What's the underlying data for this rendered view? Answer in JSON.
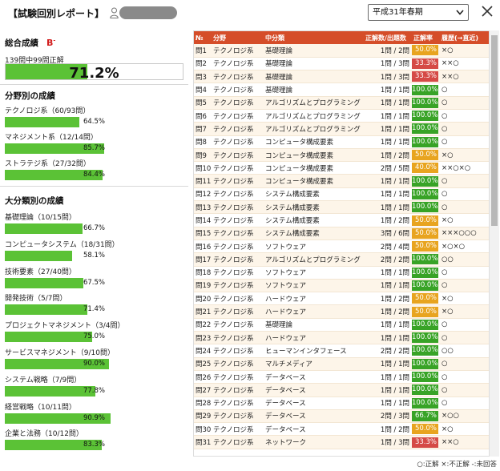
{
  "header": {
    "title": "【試験回別レポート】",
    "exam_selected": "平成31年春期"
  },
  "summary": {
    "heading": "総合成績",
    "grade": "B",
    "grade_mark": "-",
    "correct_text": "139問中99問正解",
    "rate_text": "71.2%",
    "rate": 71.2
  },
  "field": {
    "heading": "分野別の成績",
    "items": [
      {
        "label": "テクノロジ系（60/93問）",
        "pct_text": "64.5%",
        "pct": 64.5
      },
      {
        "label": "マネジメント系（12/14問）",
        "pct_text": "85.7%",
        "pct": 85.7
      },
      {
        "label": "ストラテジ系（27/32問）",
        "pct_text": "84.4%",
        "pct": 84.4
      }
    ]
  },
  "major": {
    "heading": "大分類別の成績",
    "items": [
      {
        "label": "基礎理論（10/15問）",
        "pct_text": "66.7%",
        "pct": 66.7
      },
      {
        "label": "コンピュータシステム（18/31問）",
        "pct_text": "58.1%",
        "pct": 58.1
      },
      {
        "label": "技術要素（27/40問）",
        "pct_text": "67.5%",
        "pct": 67.5
      },
      {
        "label": "開発技術（5/7問）",
        "pct_text": "71.4%",
        "pct": 71.4
      },
      {
        "label": "プロジェクトマネジメント（3/4問）",
        "pct_text": "75.0%",
        "pct": 75.0
      },
      {
        "label": "サービスマネジメント（9/10問）",
        "pct_text": "90.0%",
        "pct": 90.0
      },
      {
        "label": "システム戦略（7/9問）",
        "pct_text": "77.8%",
        "pct": 77.8
      },
      {
        "label": "経営戦略（10/11問）",
        "pct_text": "90.9%",
        "pct": 90.9
      },
      {
        "label": "企業と法務（10/12問）",
        "pct_text": "83.3%",
        "pct": 83.3
      }
    ]
  },
  "table": {
    "headers": [
      "№",
      "分野",
      "中分類",
      "正解数/出題数",
      "正解率",
      "履歴(→直近)"
    ],
    "rows": [
      {
        "no": "問1",
        "field": "テクノロジ系",
        "category": "基礎理論",
        "ratio": "1問 / 2問",
        "rate": "50.0%",
        "level": "o",
        "history": "×○"
      },
      {
        "no": "問2",
        "field": "テクノロジ系",
        "category": "基礎理論",
        "ratio": "1問 / 3問",
        "rate": "33.3%",
        "level": "r",
        "history": "××○"
      },
      {
        "no": "問3",
        "field": "テクノロジ系",
        "category": "基礎理論",
        "ratio": "1問 / 3問",
        "rate": "33.3%",
        "level": "r",
        "history": "××○"
      },
      {
        "no": "問4",
        "field": "テクノロジ系",
        "category": "基礎理論",
        "ratio": "1問 / 1問",
        "rate": "100.0%",
        "level": "g",
        "history": "○"
      },
      {
        "no": "問5",
        "field": "テクノロジ系",
        "category": "アルゴリズムとプログラミング",
        "ratio": "1問 / 1問",
        "rate": "100.0%",
        "level": "g",
        "history": "○"
      },
      {
        "no": "問6",
        "field": "テクノロジ系",
        "category": "アルゴリズムとプログラミング",
        "ratio": "1問 / 1問",
        "rate": "100.0%",
        "level": "g",
        "history": "○"
      },
      {
        "no": "問7",
        "field": "テクノロジ系",
        "category": "アルゴリズムとプログラミング",
        "ratio": "1問 / 1問",
        "rate": "100.0%",
        "level": "g",
        "history": "○"
      },
      {
        "no": "問8",
        "field": "テクノロジ系",
        "category": "コンピュータ構成要素",
        "ratio": "1問 / 1問",
        "rate": "100.0%",
        "level": "g",
        "history": "○"
      },
      {
        "no": "問9",
        "field": "テクノロジ系",
        "category": "コンピュータ構成要素",
        "ratio": "1問 / 2問",
        "rate": "50.0%",
        "level": "o",
        "history": "×○"
      },
      {
        "no": "問10",
        "field": "テクノロジ系",
        "category": "コンピュータ構成要素",
        "ratio": "2問 / 5問",
        "rate": "40.0%",
        "level": "o",
        "history": "××○×○"
      },
      {
        "no": "問11",
        "field": "テクノロジ系",
        "category": "コンピュータ構成要素",
        "ratio": "1問 / 1問",
        "rate": "100.0%",
        "level": "g",
        "history": "○"
      },
      {
        "no": "問12",
        "field": "テクノロジ系",
        "category": "システム構成要素",
        "ratio": "1問 / 1問",
        "rate": "100.0%",
        "level": "g",
        "history": "○"
      },
      {
        "no": "問13",
        "field": "テクノロジ系",
        "category": "システム構成要素",
        "ratio": "1問 / 1問",
        "rate": "100.0%",
        "level": "g",
        "history": "○"
      },
      {
        "no": "問14",
        "field": "テクノロジ系",
        "category": "システム構成要素",
        "ratio": "1問 / 2問",
        "rate": "50.0%",
        "level": "o",
        "history": "×○"
      },
      {
        "no": "問15",
        "field": "テクノロジ系",
        "category": "システム構成要素",
        "ratio": "3問 / 6問",
        "rate": "50.0%",
        "level": "o",
        "history": "×××○○○"
      },
      {
        "no": "問16",
        "field": "テクノロジ系",
        "category": "ソフトウェア",
        "ratio": "2問 / 4問",
        "rate": "50.0%",
        "level": "o",
        "history": "×○×○"
      },
      {
        "no": "問17",
        "field": "テクノロジ系",
        "category": "アルゴリズムとプログラミング",
        "ratio": "2問 / 2問",
        "rate": "100.0%",
        "level": "g",
        "history": "○○"
      },
      {
        "no": "問18",
        "field": "テクノロジ系",
        "category": "ソフトウェア",
        "ratio": "1問 / 1問",
        "rate": "100.0%",
        "level": "g",
        "history": "○"
      },
      {
        "no": "問19",
        "field": "テクノロジ系",
        "category": "ソフトウェア",
        "ratio": "1問 / 1問",
        "rate": "100.0%",
        "level": "g",
        "history": "○"
      },
      {
        "no": "問20",
        "field": "テクノロジ系",
        "category": "ハードウェア",
        "ratio": "1問 / 2問",
        "rate": "50.0%",
        "level": "o",
        "history": "×○"
      },
      {
        "no": "問21",
        "field": "テクノロジ系",
        "category": "ハードウェア",
        "ratio": "1問 / 2問",
        "rate": "50.0%",
        "level": "o",
        "history": "×○"
      },
      {
        "no": "問22",
        "field": "テクノロジ系",
        "category": "基礎理論",
        "ratio": "1問 / 1問",
        "rate": "100.0%",
        "level": "g",
        "history": "○"
      },
      {
        "no": "問23",
        "field": "テクノロジ系",
        "category": "ハードウェア",
        "ratio": "1問 / 1問",
        "rate": "100.0%",
        "level": "g",
        "history": "○"
      },
      {
        "no": "問24",
        "field": "テクノロジ系",
        "category": "ヒューマンインタフェース",
        "ratio": "2問 / 2問",
        "rate": "100.0%",
        "level": "g",
        "history": "○○"
      },
      {
        "no": "問25",
        "field": "テクノロジ系",
        "category": "マルチメディア",
        "ratio": "1問 / 1問",
        "rate": "100.0%",
        "level": "g",
        "history": "○"
      },
      {
        "no": "問26",
        "field": "テクノロジ系",
        "category": "データベース",
        "ratio": "1問 / 1問",
        "rate": "100.0%",
        "level": "g",
        "history": "○"
      },
      {
        "no": "問27",
        "field": "テクノロジ系",
        "category": "データベース",
        "ratio": "1問 / 1問",
        "rate": "100.0%",
        "level": "g",
        "history": "○"
      },
      {
        "no": "問28",
        "field": "テクノロジ系",
        "category": "データベース",
        "ratio": "1問 / 1問",
        "rate": "100.0%",
        "level": "g",
        "history": "○"
      },
      {
        "no": "問29",
        "field": "テクノロジ系",
        "category": "データベース",
        "ratio": "2問 / 3問",
        "rate": "66.7%",
        "level": "g",
        "history": "×○○"
      },
      {
        "no": "問30",
        "field": "テクノロジ系",
        "category": "データベース",
        "ratio": "1問 / 2問",
        "rate": "50.0%",
        "level": "o",
        "history": "×○"
      },
      {
        "no": "問31",
        "field": "テクノロジ系",
        "category": "ネットワーク",
        "ratio": "1問 / 3問",
        "rate": "33.3%",
        "level": "r",
        "history": "××○"
      }
    ]
  },
  "legend": "○:正解 ×:不正解 -:未回答",
  "colors": {
    "header_bg": "#d54d29",
    "bar_green": "#5bc236",
    "chip_green": "#38a326",
    "chip_orange": "#e8a41f",
    "chip_red": "#d54a46",
    "row_tint": "#fdf5e9"
  }
}
